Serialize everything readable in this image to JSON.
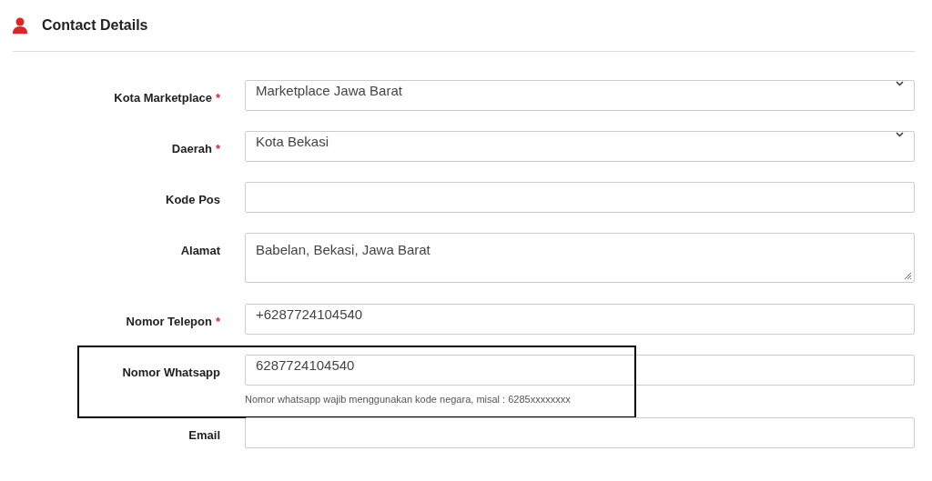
{
  "section": {
    "title": "Contact Details"
  },
  "fields": [
    {
      "kind": "select",
      "label": "Kota Marketplace",
      "required_mark": "*",
      "value": "Marketplace Jawa Barat",
      "highlighted": false
    },
    {
      "kind": "select",
      "label": "Daerah",
      "required_mark": "*",
      "value": "Kota Bekasi",
      "highlighted": false
    },
    {
      "kind": "input",
      "label": "Kode Pos",
      "highlighted": false
    },
    {
      "kind": "textarea",
      "label": "Alamat",
      "value": "Babelan, Bekasi, Jawa Barat",
      "highlighted": false
    },
    {
      "kind": "input",
      "label": "Nomor Telepon",
      "required_mark": "*",
      "value": "+6287724104540",
      "highlighted": false
    },
    {
      "kind": "input",
      "label": "Nomor Whatsapp",
      "value": "6287724104540",
      "help": "Nomor whatsapp wajib menggunakan kode negara, misal : 6285xxxxxxxx",
      "highlighted": true
    },
    {
      "kind": "input",
      "label": "Email",
      "highlighted": false
    }
  ]
}
